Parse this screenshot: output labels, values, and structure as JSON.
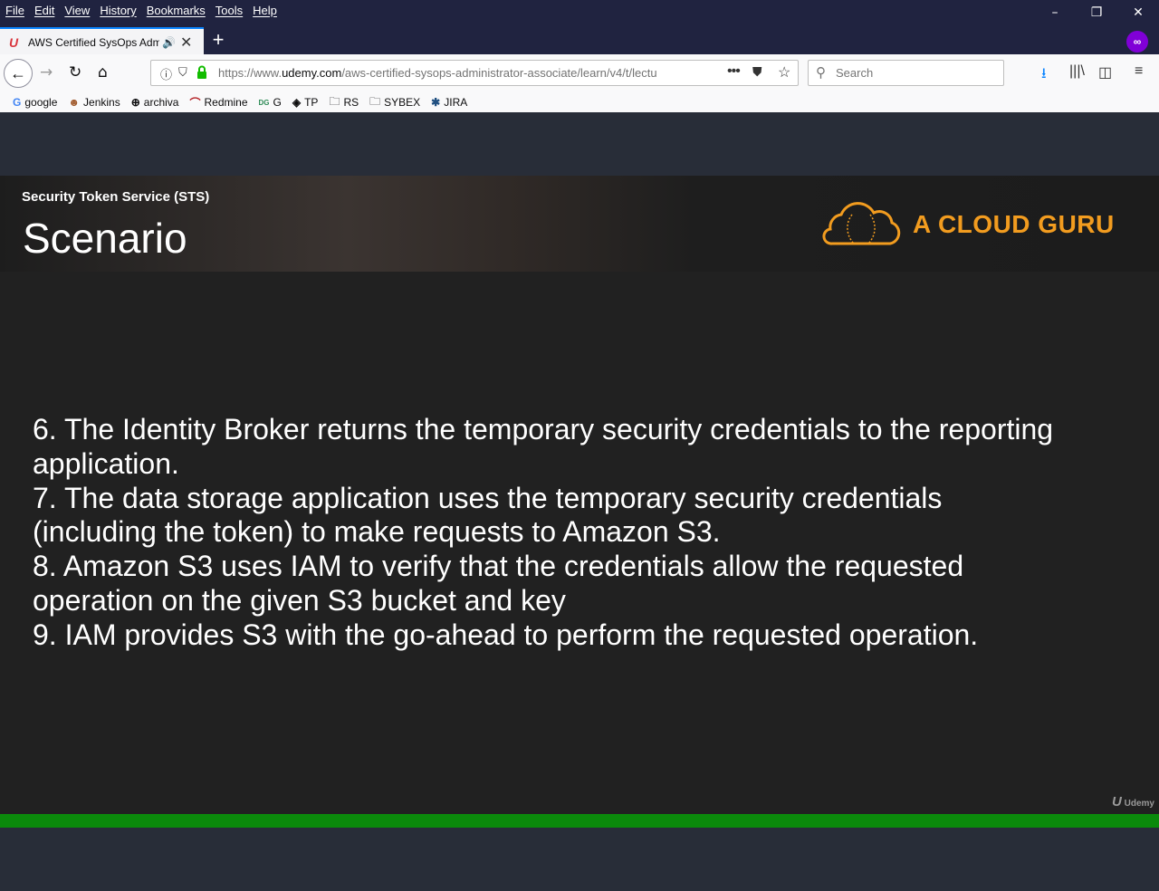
{
  "menubar": [
    "File",
    "Edit",
    "View",
    "History",
    "Bookmarks",
    "Tools",
    "Help"
  ],
  "window_controls": {
    "minimize": "–",
    "maximize": "❐",
    "close": "✕"
  },
  "tab": {
    "title": "AWS Certified SysOps Admin",
    "audio_icon": "speaker-icon",
    "favicon": "udemy-icon"
  },
  "newtab_label": "+",
  "navbar": {
    "url_scheme": "https://www.",
    "url_domain": "udemy.com",
    "url_path": "/aws-certified-sysops-administrator-associate/learn/v4/t/lectu",
    "search_placeholder": "Search"
  },
  "bookmarks": [
    {
      "label": "google",
      "icon": "google-icon"
    },
    {
      "label": "Jenkins",
      "icon": "jenkins-icon"
    },
    {
      "label": "archiva",
      "icon": "globe-icon"
    },
    {
      "label": "Redmine",
      "icon": "redmine-icon"
    },
    {
      "label": "G",
      "icon": "dg-icon"
    },
    {
      "label": "TP",
      "icon": "diamond-icon"
    },
    {
      "label": "RS",
      "icon": "folder-icon"
    },
    {
      "label": "SYBEX",
      "icon": "folder-icon"
    },
    {
      "label": "JIRA",
      "icon": "jira-icon"
    }
  ],
  "slide": {
    "subtitle": "Security Token Service (STS)",
    "title": "Scenario",
    "brand": "A CLOUD GURU",
    "lines": [
      "6.  The Identity Broker returns the temporary security credentials to the reporting",
      "application.",
      "7.  The data storage application uses the temporary security credentials",
      "(including the token) to make requests to Amazon S3.",
      "8.  Amazon S3 uses IAM to verify that the credentials allow the requested",
      "operation on the given S3 bucket and key",
      "9.  IAM provides S3 with the go-ahead to perform the requested operation."
    ],
    "watermark": "Udemy"
  },
  "colors": {
    "brand_orange": "#f29c1f",
    "progress_green": "#0b8a0b"
  }
}
